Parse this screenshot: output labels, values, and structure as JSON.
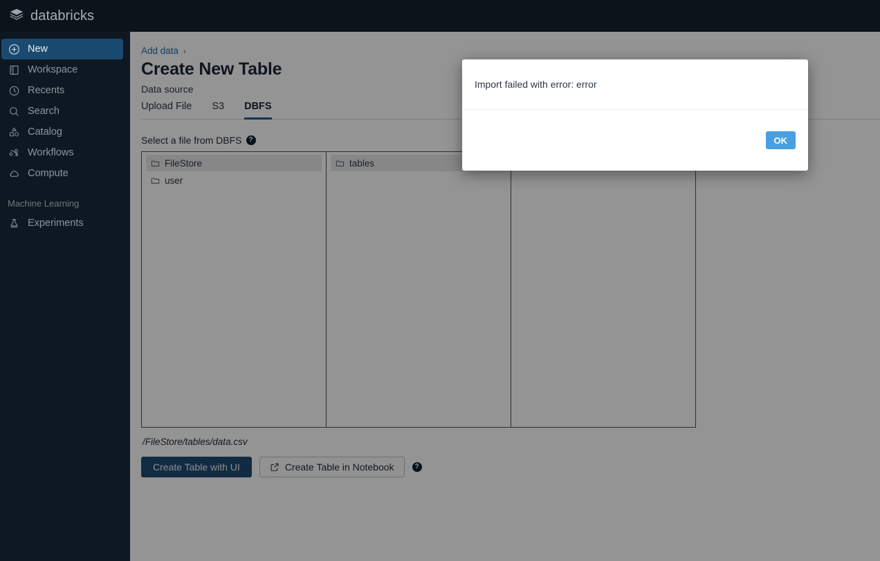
{
  "brand": {
    "name": "databricks",
    "logo_icon": "databricks-layers-icon",
    "accent": "#1b4a70"
  },
  "sidebar": {
    "items": [
      {
        "label": "New",
        "icon": "plus-circle-icon",
        "active": true
      },
      {
        "label": "Workspace",
        "icon": "workspace-icon",
        "active": false
      },
      {
        "label": "Recents",
        "icon": "clock-icon",
        "active": false
      },
      {
        "label": "Search",
        "icon": "search-icon",
        "active": false
      },
      {
        "label": "Catalog",
        "icon": "catalog-icon",
        "active": false
      },
      {
        "label": "Workflows",
        "icon": "workflows-icon",
        "active": false
      },
      {
        "label": "Compute",
        "icon": "cloud-icon",
        "active": false
      }
    ],
    "section_label": "Machine Learning",
    "ml_items": [
      {
        "label": "Experiments",
        "icon": "experiments-flask-icon",
        "active": false
      }
    ]
  },
  "breadcrumb": {
    "parent": "Add data",
    "separator": "›"
  },
  "page": {
    "title": "Create New Table",
    "subtitle": "Data source"
  },
  "tabs": [
    {
      "label": "Upload File",
      "active": false
    },
    {
      "label": "S3",
      "active": false
    },
    {
      "label": "DBFS",
      "active": true
    }
  ],
  "file_browser": {
    "label": "Select a file from DBFS",
    "help_icon": "question-mark-icon",
    "help_glyph": "?",
    "columns": [
      {
        "items": [
          {
            "name": "FileStore",
            "icon": "folder-icon",
            "selected": true
          },
          {
            "name": "user",
            "icon": "folder-icon",
            "selected": false
          }
        ]
      },
      {
        "items": [
          {
            "name": "tables",
            "icon": "folder-icon",
            "selected": true
          }
        ]
      },
      {
        "items": []
      }
    ],
    "selected_path": "/FileStore/tables/data.csv"
  },
  "actions": {
    "primary_label": "Create Table with UI",
    "secondary_label": "Create Table in Notebook",
    "secondary_icon": "external-link-icon",
    "help_icon": "question-mark-icon",
    "help_glyph": "?"
  },
  "modal": {
    "message": "Import failed with error: error",
    "ok_label": "OK",
    "ok_color": "#4a9fe0"
  }
}
